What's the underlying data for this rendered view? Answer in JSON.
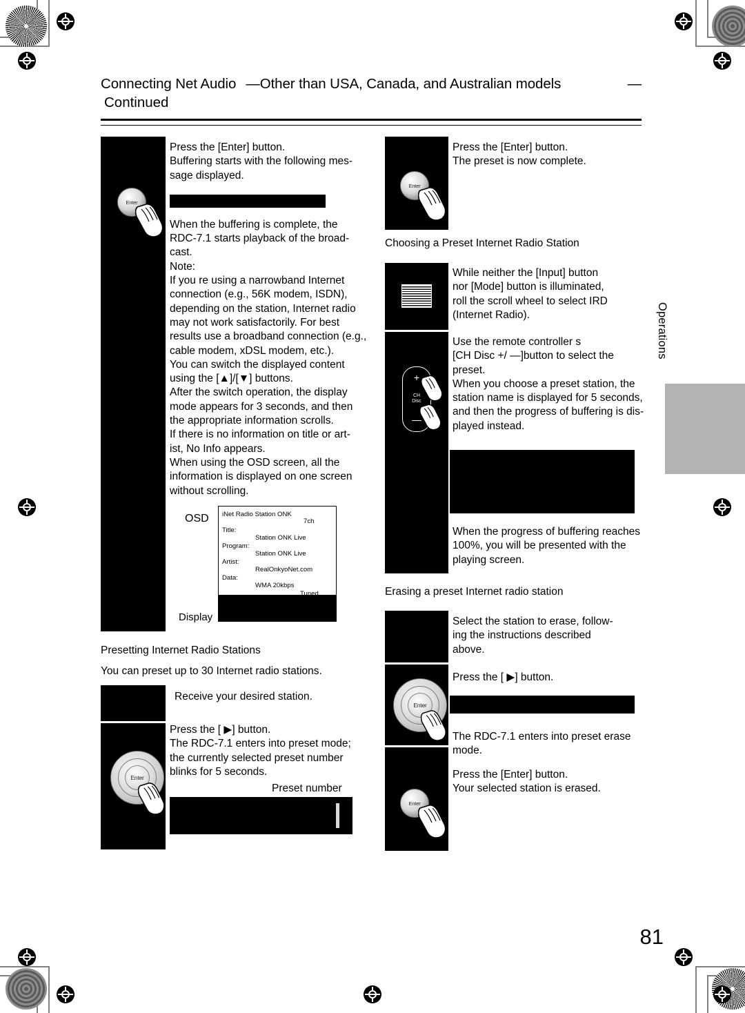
{
  "document": {
    "page_number": "81",
    "side_tab": "Operations",
    "header": {
      "title_main": "Connecting Net Audio",
      "title_dash_left": "—",
      "title_sub": "Other than USA, Canada, and Australian models",
      "title_dash_right": "—",
      "continued": "Continued"
    }
  },
  "left_column": {
    "steps": [
      {
        "illustration": "enter-button-press",
        "lines": [
          "Press the [Enter] button.",
          "Buffering starts with the following mes-",
          "sage displayed."
        ]
      }
    ],
    "buffering_bar": "",
    "body_lines": [
      "When the buffering is complete, the",
      "RDC-7.1 starts playback of the broad-",
      "cast.",
      "Note:",
      "If you re using a narrowband Internet",
      "connection (e.g., 56K modem, ISDN),",
      "depending on the station, Internet radio",
      "may not work satisfactorily. For best",
      "results use a broadband connection (e.g.,",
      "cable modem, xDSL modem, etc.).",
      "You can switch the displayed content",
      "using the [▲]/[▼] buttons.",
      "After the switch operation, the display",
      "mode appears for 3 seconds, and then",
      "the appropriate information scrolls.",
      "If there is no information on title or art-",
      "ist, No Info appears.",
      "When using the OSD screen, all the",
      "information is displayed on one screen",
      "without scrolling."
    ],
    "osd": {
      "osd_label": "OSD",
      "display_label": "Display",
      "station_line": "iNet Radio Station ONK",
      "channel": "7ch",
      "rows": [
        {
          "label": "Title:",
          "value": "Station ONK Live"
        },
        {
          "label": "Program:",
          "value": "Station ONK Live"
        },
        {
          "label": "Artist:",
          "value": "RealOnkyoNet.com"
        },
        {
          "label": "Data:",
          "value": "WMA  20kbps"
        }
      ],
      "status": "Tuned"
    },
    "presetting": {
      "heading": "Presetting Internet Radio Stations",
      "intro": "You can preset up to 30 Internet radio stations.",
      "step1": [
        "Receive your desired station."
      ],
      "step2": [
        "Press the [ ▶] button.",
        "The RDC-7.1 enters into preset mode;",
        "the currently selected preset number",
        "blinks for 5 seconds."
      ],
      "preset_number_caption": "Preset number"
    }
  },
  "right_column": {
    "step_enter_complete": [
      "Press the [Enter] button.",
      "The preset is now complete."
    ],
    "choosing_heading": "Choosing a Preset Internet Radio Station",
    "step_scroll_wheel": [
      "While neither the [Input] button",
      "nor [Mode] button is illuminated,",
      "roll the scroll wheel to select IRD",
      "(Internet Radio)."
    ],
    "step_chdisc": [
      "Use the remote controller    s",
      "[CH Disc +/ —]button to select the",
      "preset.",
      "When you choose a preset station, the",
      "station name is displayed for 5 seconds,",
      "and then the progress of buffering is dis-",
      "played instead."
    ],
    "chdisc_key": {
      "plus": "+",
      "name_line1": "CH",
      "name_line2": "Disc",
      "minus": "—"
    },
    "step_buffering_100": [
      "When the progress of buffering reaches",
      "100%, you will be presented with the",
      "playing screen."
    ],
    "erasing_heading": "Erasing a preset Internet radio station",
    "step_select_erase": [
      "Select the station to erase, follow-",
      "ing the instructions described",
      "above."
    ],
    "step_press_play": [
      "Press the [ ▶] button."
    ],
    "step_erase_mode": [
      "The RDC-7.1 enters into preset erase",
      "mode."
    ],
    "step_enter_erase": [
      "Press the [Enter] button.",
      "Your selected station is erased."
    ]
  },
  "colors": {
    "illustration_bg": "#000000",
    "side_tab_bg": "#b3b3b3",
    "text": "#000000",
    "crop_mark": "#808080"
  }
}
